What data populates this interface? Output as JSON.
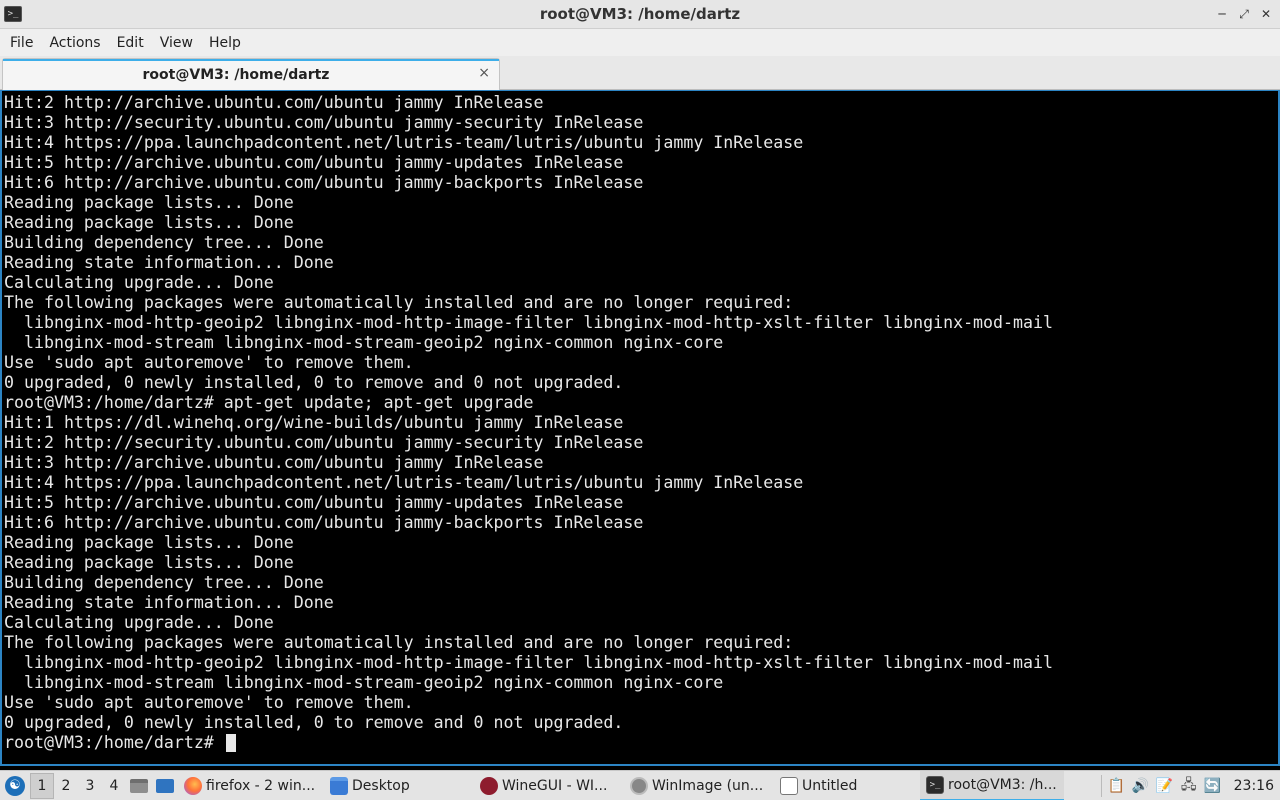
{
  "window": {
    "title": "root@VM3: /home/dartz",
    "app_icon": "terminal-icon",
    "controls": [
      "minimize-icon",
      "maximize-icon",
      "close-icon"
    ]
  },
  "menu": [
    "File",
    "Actions",
    "Edit",
    "View",
    "Help"
  ],
  "tab": {
    "label": "root@VM3: /home/dartz",
    "close": "×"
  },
  "terminal": {
    "lines": [
      "Hit:2 http://archive.ubuntu.com/ubuntu jammy InRelease",
      "Hit:3 http://security.ubuntu.com/ubuntu jammy-security InRelease",
      "Hit:4 https://ppa.launchpadcontent.net/lutris-team/lutris/ubuntu jammy InRelease",
      "Hit:5 http://archive.ubuntu.com/ubuntu jammy-updates InRelease",
      "Hit:6 http://archive.ubuntu.com/ubuntu jammy-backports InRelease",
      "Reading package lists... Done",
      "Reading package lists... Done",
      "Building dependency tree... Done",
      "Reading state information... Done",
      "Calculating upgrade... Done",
      "The following packages were automatically installed and are no longer required:",
      "  libnginx-mod-http-geoip2 libnginx-mod-http-image-filter libnginx-mod-http-xslt-filter libnginx-mod-mail",
      "  libnginx-mod-stream libnginx-mod-stream-geoip2 nginx-common nginx-core",
      "Use 'sudo apt autoremove' to remove them.",
      "0 upgraded, 0 newly installed, 0 to remove and 0 not upgraded.",
      "root@VM3:/home/dartz# apt-get update; apt-get upgrade",
      "Hit:1 https://dl.winehq.org/wine-builds/ubuntu jammy InRelease",
      "Hit:2 http://security.ubuntu.com/ubuntu jammy-security InRelease",
      "Hit:3 http://archive.ubuntu.com/ubuntu jammy InRelease",
      "Hit:4 https://ppa.launchpadcontent.net/lutris-team/lutris/ubuntu jammy InRelease",
      "Hit:5 http://archive.ubuntu.com/ubuntu jammy-updates InRelease",
      "Hit:6 http://archive.ubuntu.com/ubuntu jammy-backports InRelease",
      "Reading package lists... Done",
      "Reading package lists... Done",
      "Building dependency tree... Done",
      "Reading state information... Done",
      "Calculating upgrade... Done",
      "The following packages were automatically installed and are no longer required:",
      "  libnginx-mod-http-geoip2 libnginx-mod-http-image-filter libnginx-mod-http-xslt-filter libnginx-mod-mail",
      "  libnginx-mod-stream libnginx-mod-stream-geoip2 nginx-common nginx-core",
      "Use 'sudo apt autoremove' to remove them.",
      "0 upgraded, 0 newly installed, 0 to remove and 0 not upgraded."
    ],
    "prompt": "root@VM3:/home/dartz# "
  },
  "taskbar": {
    "start_icon": "lubuntu-logo-icon",
    "workspaces": [
      "1",
      "2",
      "3",
      "4"
    ],
    "active_workspace": "1",
    "quick_launch": [
      "file-manager-icon",
      "show-desktop-icon"
    ],
    "tasks": [
      {
        "label": "firefox - 2 win...",
        "icon": "firefox-icon"
      },
      {
        "label": "Desktop",
        "icon": "folder-icon"
      },
      {
        "label": "WineGUI - WI...",
        "icon": "wine-icon"
      },
      {
        "label": "WinImage (un...",
        "icon": "winimage-icon"
      },
      {
        "label": "Untitled",
        "icon": "document-icon"
      },
      {
        "label": "root@VM3: /h...",
        "icon": "terminal-icon",
        "active": true
      }
    ],
    "tray": [
      "clipboard-icon",
      "volume-icon",
      "notes-icon",
      "network-icon",
      "update-icon"
    ],
    "clock": "23:16"
  },
  "colors": {
    "terminal_bg": "#000000",
    "terminal_fg": "#e8e8e8",
    "accent": "#3daee9",
    "terminal_border": "#2c84c4"
  }
}
